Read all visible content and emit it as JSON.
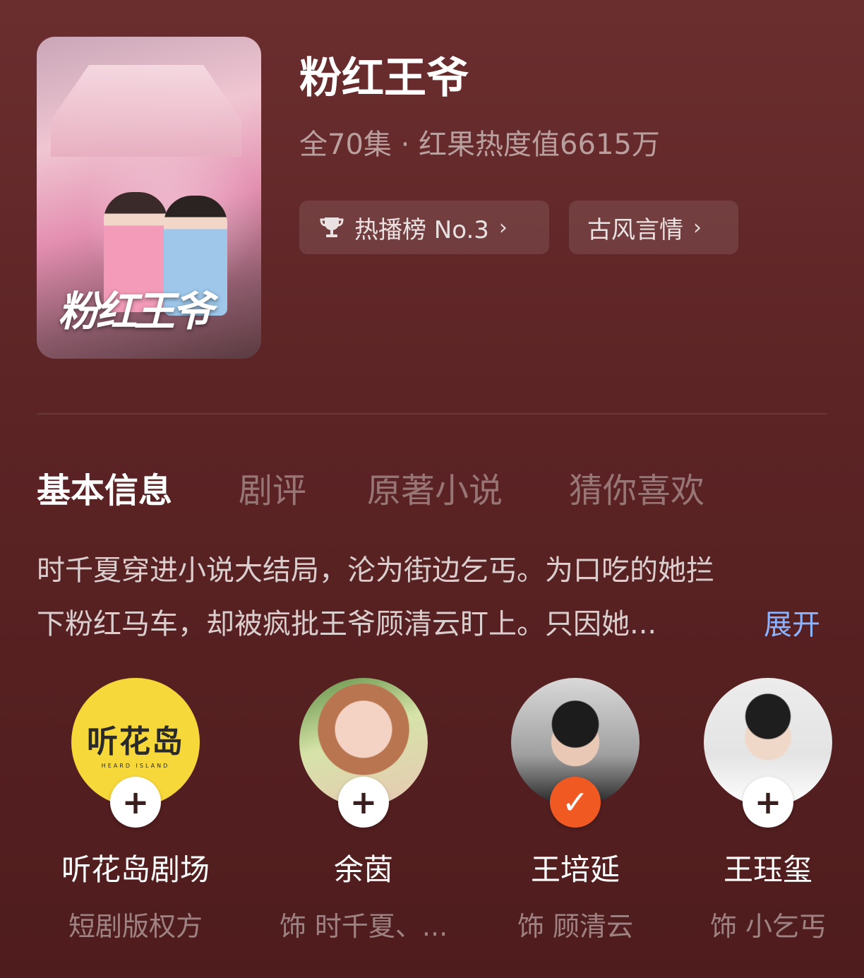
{
  "drama": {
    "title": "粉红王爷",
    "cover_title": "粉红王爷",
    "meta": "全70集 · 红果热度值6615万",
    "rank_tag": "热播榜 No.3",
    "genre_tag": "古风言情"
  },
  "tabs": [
    {
      "label": "基本信息",
      "active": true
    },
    {
      "label": "剧评",
      "active": false
    },
    {
      "label": "原著小说",
      "active": false
    },
    {
      "label": "猜你喜欢",
      "active": false
    }
  ],
  "synopsis": {
    "line1": "时千夏穿进小说大结局，沦为街边乞丐。为口吃的她拦",
    "line2": "下粉红马车，却被疯批王爷顾清云盯上。只因她...",
    "expand_label": "展开"
  },
  "cast": [
    {
      "name": "听花岛剧场",
      "role": "短剧版权方",
      "logo_text": "听花岛",
      "logo_sub": "HEARD ISLAND",
      "followed": false
    },
    {
      "name": "余茵",
      "role": "饰 时千夏、...",
      "followed": false
    },
    {
      "name": "王培延",
      "role": "饰 顾清云",
      "followed": true
    },
    {
      "name": "王珏玺",
      "role": "饰 小乞丐",
      "followed": false
    }
  ],
  "icons": {
    "rank": "trophy-icon",
    "chevron": "chevron-right-icon",
    "follow": "plus-icon",
    "followed": "check-icon"
  },
  "colors": {
    "background": "#5b2324",
    "link": "#8cb3ff",
    "followed_badge": "#f05a22",
    "logo_yellow": "#f6d83b"
  }
}
